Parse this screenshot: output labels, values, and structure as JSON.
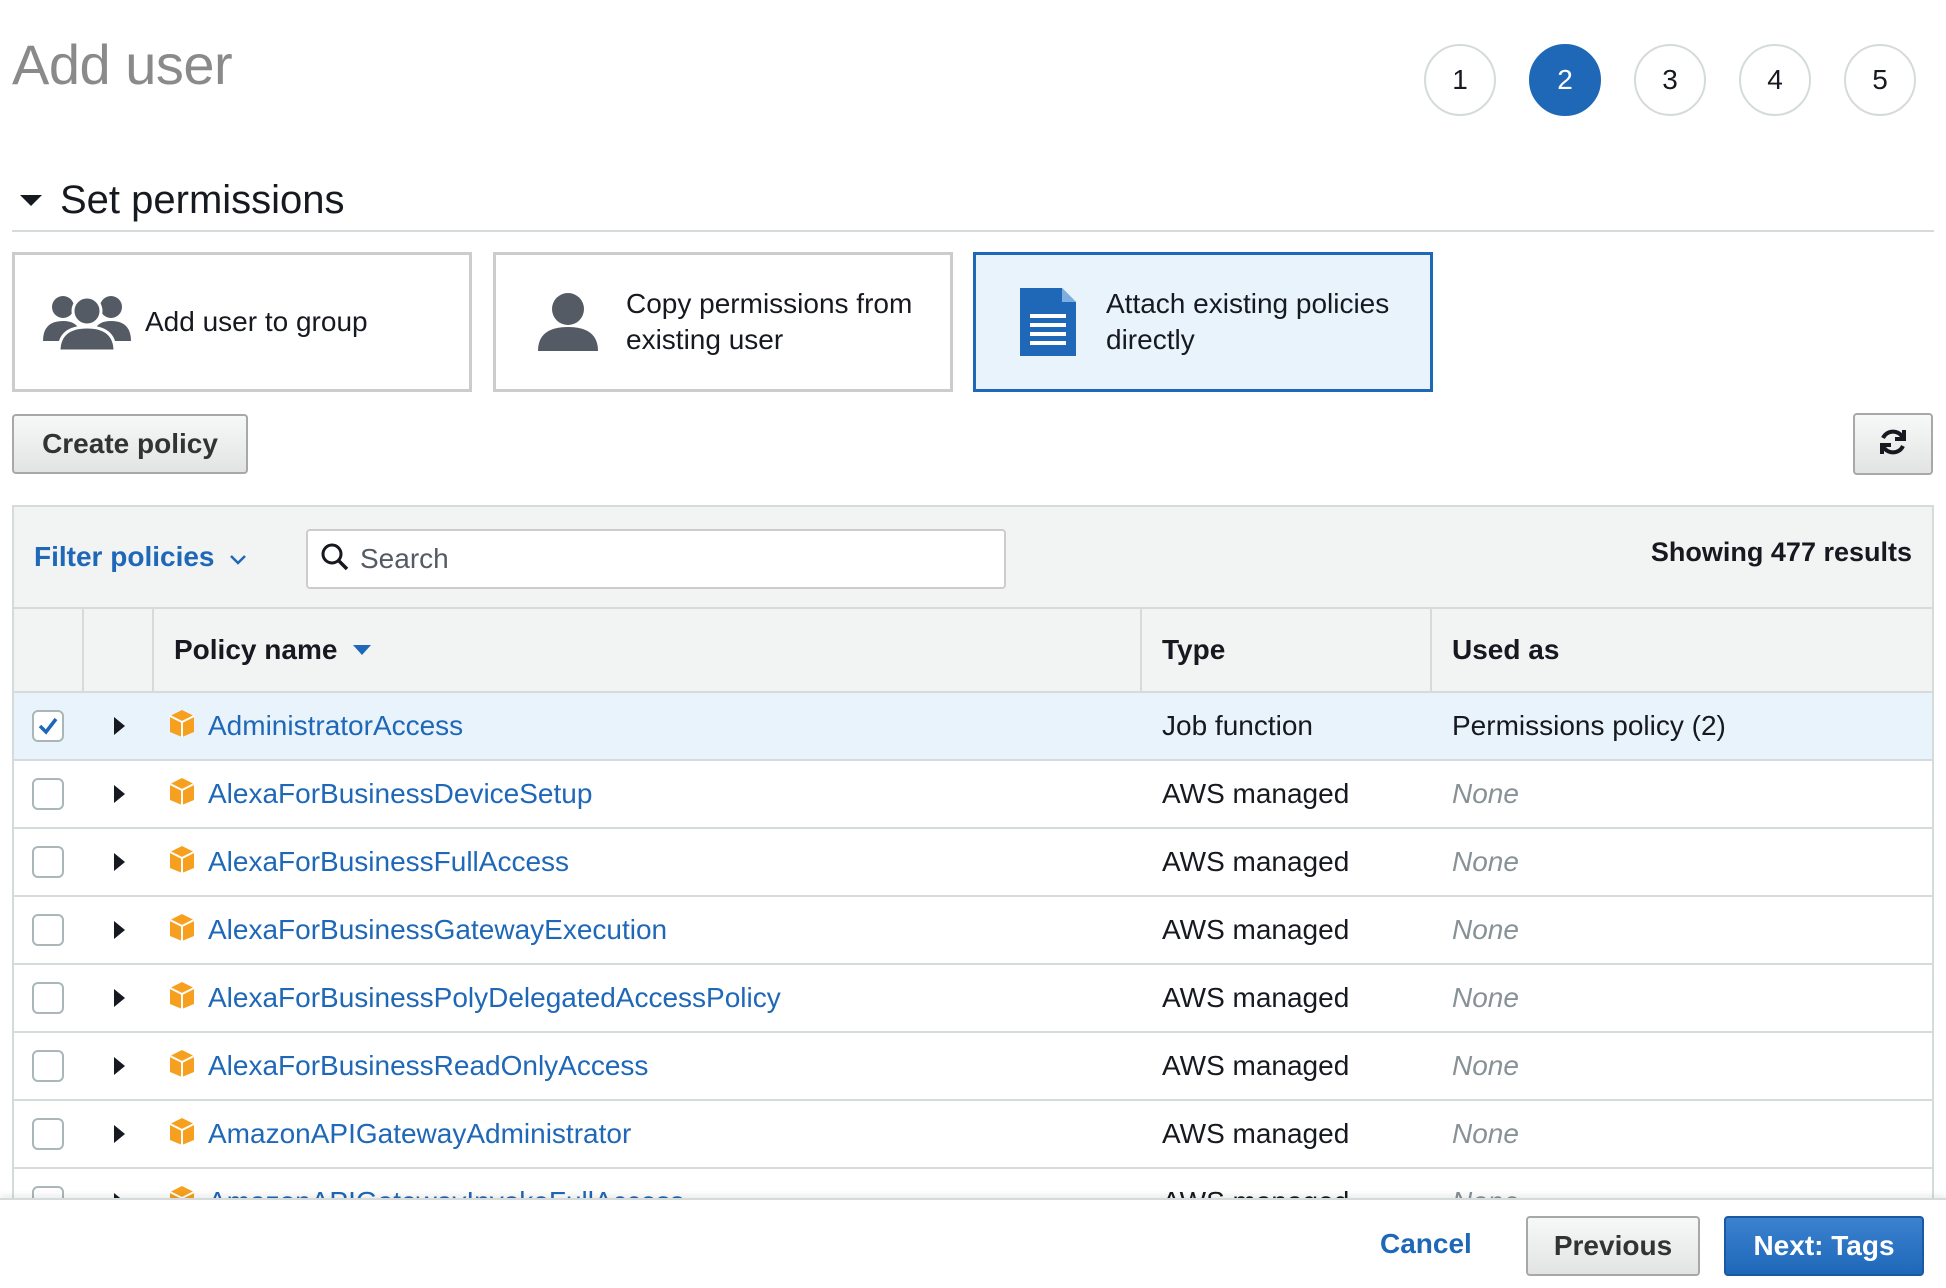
{
  "page": {
    "title": "Add user"
  },
  "steps": [
    {
      "label": "1",
      "active": false
    },
    {
      "label": "2",
      "active": true
    },
    {
      "label": "3",
      "active": false
    },
    {
      "label": "4",
      "active": false
    },
    {
      "label": "5",
      "active": false
    }
  ],
  "section": {
    "title": "Set permissions"
  },
  "options": {
    "add_to_group": {
      "label": "Add user to group",
      "icon": "users-group-icon"
    },
    "copy_permissions": {
      "label_line1": "Copy permissions from",
      "label_line2": "existing user",
      "icon": "user-icon"
    },
    "attach_policies": {
      "label_line1": "Attach existing policies",
      "label_line2": "directly",
      "icon": "document-icon",
      "selected": true
    }
  },
  "toolbar": {
    "create_policy_label": "Create policy",
    "refresh_icon": "refresh-icon"
  },
  "filter": {
    "filter_label": "Filter policies",
    "search_placeholder": "Search",
    "results_text": "Showing 477 results"
  },
  "table": {
    "columns": {
      "name": "Policy name",
      "type": "Type",
      "used_as": "Used as"
    },
    "rows": [
      {
        "name": "AdministratorAccess",
        "type": "Job function",
        "used_as": "Permissions policy (2)",
        "checked": true
      },
      {
        "name": "AlexaForBusinessDeviceSetup",
        "type": "AWS managed",
        "used_as": "None",
        "checked": false
      },
      {
        "name": "AlexaForBusinessFullAccess",
        "type": "AWS managed",
        "used_as": "None",
        "checked": false
      },
      {
        "name": "AlexaForBusinessGatewayExecution",
        "type": "AWS managed",
        "used_as": "None",
        "checked": false
      },
      {
        "name": "AlexaForBusinessPolyDelegatedAccessPolicy",
        "type": "AWS managed",
        "used_as": "None",
        "checked": false
      },
      {
        "name": "AlexaForBusinessReadOnlyAccess",
        "type": "AWS managed",
        "used_as": "None",
        "checked": false
      },
      {
        "name": "AmazonAPIGatewayAdministrator",
        "type": "AWS managed",
        "used_as": "None",
        "checked": false
      },
      {
        "name": "AmazonAPIGatewayInvokeFullAccess",
        "type": "AWS managed",
        "used_as": "None",
        "checked": false
      }
    ]
  },
  "footer": {
    "cancel_label": "Cancel",
    "previous_label": "Previous",
    "next_label": "Next: Tags"
  },
  "colors": {
    "accent": "#1f68b8",
    "selected_bg": "#e9f3fc",
    "policy_icon": "#f7a01f"
  }
}
